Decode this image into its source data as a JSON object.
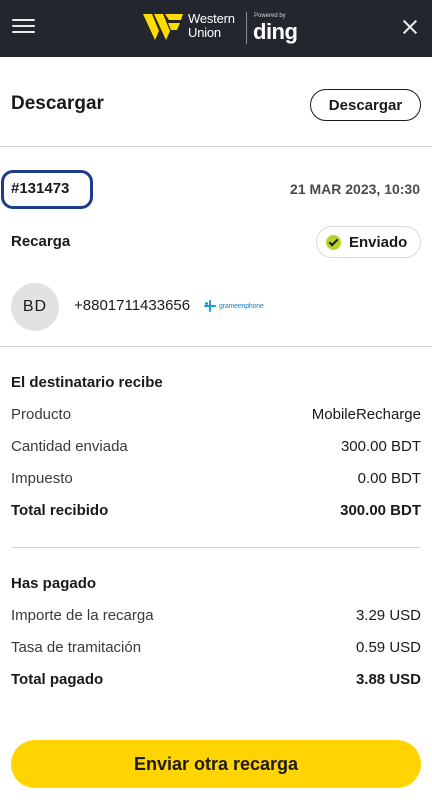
{
  "header": {
    "brand_name": "Western\nUnion",
    "powered_by": "Powered by",
    "partner": "ding",
    "colors": {
      "bar": "#23272d",
      "wu_yellow": "#ffdd00"
    }
  },
  "page": {
    "title": "Descargar",
    "download_label": "Descargar"
  },
  "order": {
    "id": "#131473",
    "date": "21 MAR 2023, 10:30"
  },
  "recharge": {
    "label": "Recarga",
    "status": "Enviado",
    "avatar_initials": "BD",
    "phone": "+8801711433656",
    "operator": "grameenphone"
  },
  "recipient": {
    "title": "El destinatario recibe",
    "rows": [
      {
        "label": "Producto",
        "value": "MobileRecharge"
      },
      {
        "label": "Cantidad enviada",
        "value": "300.00 BDT"
      },
      {
        "label": "Impuesto",
        "value": "0.00 BDT"
      },
      {
        "label": "Total recibido",
        "value": "300.00 BDT"
      }
    ]
  },
  "paid": {
    "title": "Has pagado",
    "rows": [
      {
        "label": "Importe de la recarga",
        "value": "3.29 USD"
      },
      {
        "label": "Tasa de tramitación",
        "value": "0.59 USD"
      },
      {
        "label": "Total pagado",
        "value": "3.88 USD"
      }
    ]
  },
  "cta": {
    "label": "Enviar otra recarga",
    "color": "#ffd400"
  },
  "colors": {
    "status_check": "#b8d42b",
    "highlight_border": "#1d3c8a"
  }
}
